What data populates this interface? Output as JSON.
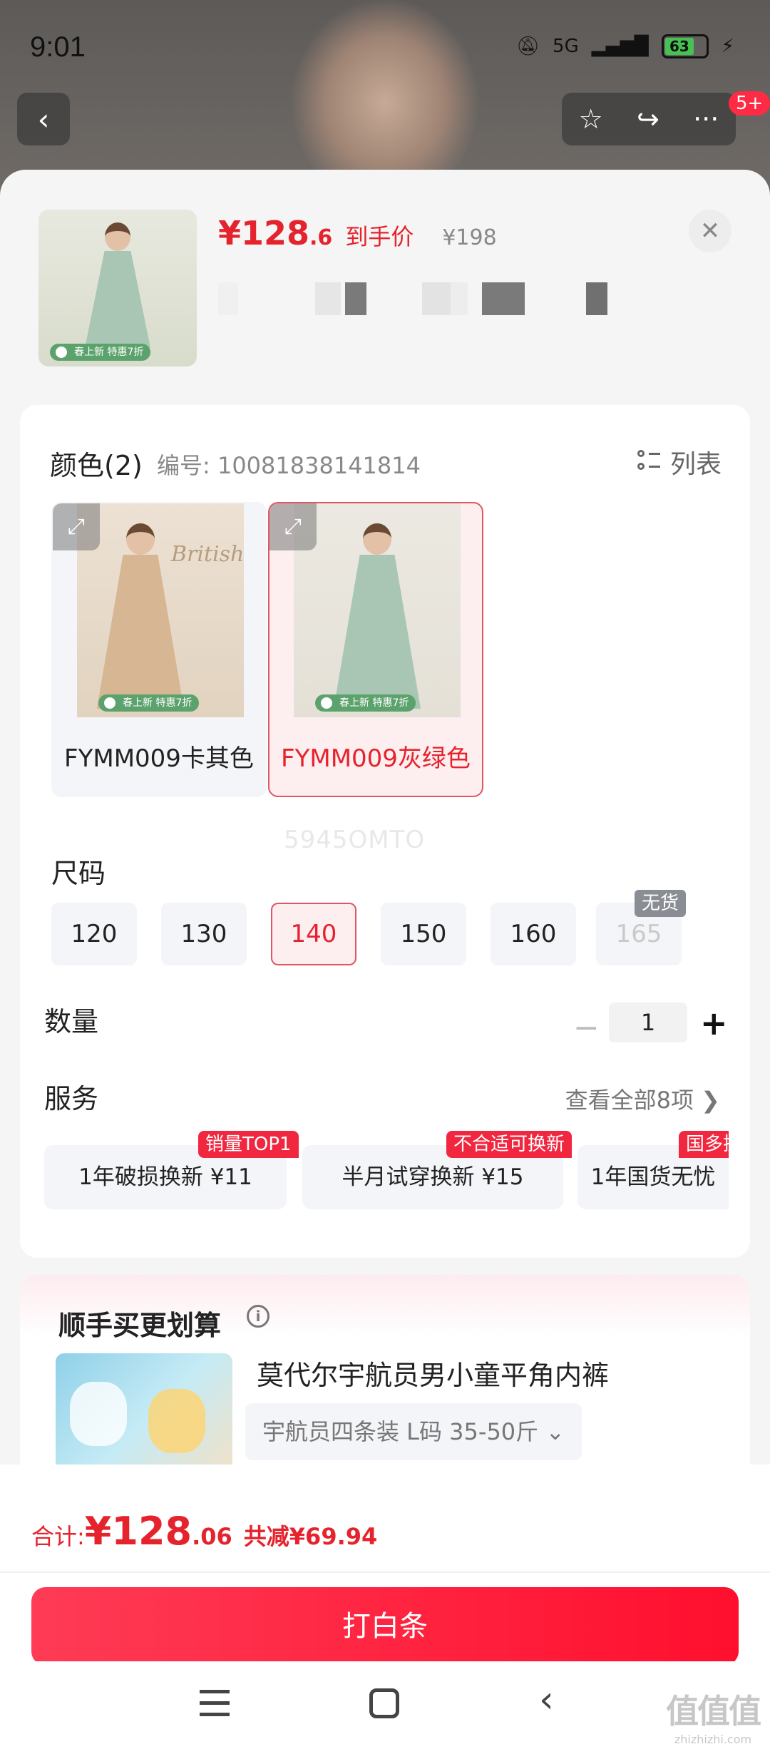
{
  "status_bar": {
    "time": "9:01",
    "network": "5G",
    "battery": "63"
  },
  "nav": {
    "notification_badge": "5+"
  },
  "product": {
    "price_main": "¥128",
    "price_decimal": ".6",
    "price_label": "到手价",
    "original_price": "¥198",
    "thumb_promo": "春上新 特惠7折"
  },
  "color_section": {
    "title": "颜色(2)",
    "sku_code": "编号: 10081838141814",
    "list_toggle": "列表",
    "options": [
      {
        "label": "FYMM009卡其色",
        "promo": "春上新 特惠7折",
        "image_note": "British",
        "coat_color": "#d7b693"
      },
      {
        "label": "FYMM009灰绿色",
        "promo": "春上新 特惠7折",
        "coat_color": "#a8c6b3",
        "selected": true
      }
    ]
  },
  "watermark": "5945OMTO",
  "size_section": {
    "title": "尺码",
    "options": [
      "120",
      "130",
      "140",
      "150",
      "160",
      "165"
    ],
    "selected": "140",
    "soldout_tag": "无货"
  },
  "quantity_section": {
    "title": "数量",
    "value": "1"
  },
  "service_section": {
    "title": "服务",
    "view_all": "查看全部8项 ❯",
    "items": [
      {
        "label": "1年破损换新 ¥11",
        "tag": "销量TOP1"
      },
      {
        "label": "半月试穿换新 ¥15",
        "tag": "不合适可换新"
      },
      {
        "label": "1年国货无忧",
        "tag": "国多换"
      }
    ]
  },
  "bundle": {
    "title": "顺手买更划算",
    "product_name": "莫代尔宇航员男小童平角内裤",
    "spec": "宇航员四条装 L码 35-50斤 ⌄"
  },
  "checkout": {
    "total_label": "合计: ",
    "total_main": "¥128",
    "total_decimal": ".06",
    "saved": "共减¥69.94",
    "pay_button": "打白条"
  },
  "site_watermark": {
    "big": "值值值",
    "small": "zhizhizhi.com"
  },
  "colors": {
    "accent_red": "#e5232d",
    "button_red": "#ff1f3d",
    "selected_bg": "#fdeef0"
  }
}
